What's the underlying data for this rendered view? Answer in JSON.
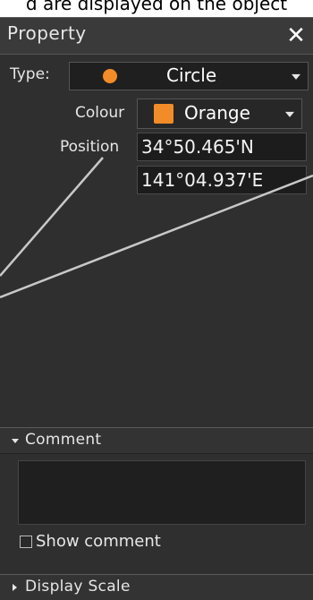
{
  "caption": {
    "text": "d are displayed on the object"
  },
  "panel": {
    "title": "Property",
    "close_symbol": "✕"
  },
  "type_row": {
    "label": "Type:",
    "value": "Circle",
    "icon": "orange-circle-icon"
  },
  "colour_row": {
    "label": "Colour",
    "value": "Orange",
    "color": "#f28c28"
  },
  "position_row": {
    "label": "Position",
    "lat": "34°50.465'N",
    "lon": "141°04.937'E"
  },
  "comment_section": {
    "label": "Comment",
    "show_comment_label": "Show comment",
    "show_comment_checked": false
  },
  "display_scale_section": {
    "label": "Display Scale"
  },
  "colors": {
    "panel_bg": "#2f2f2f",
    "accent_orange": "#f28c28",
    "leader_line": "#c8c8c8"
  }
}
